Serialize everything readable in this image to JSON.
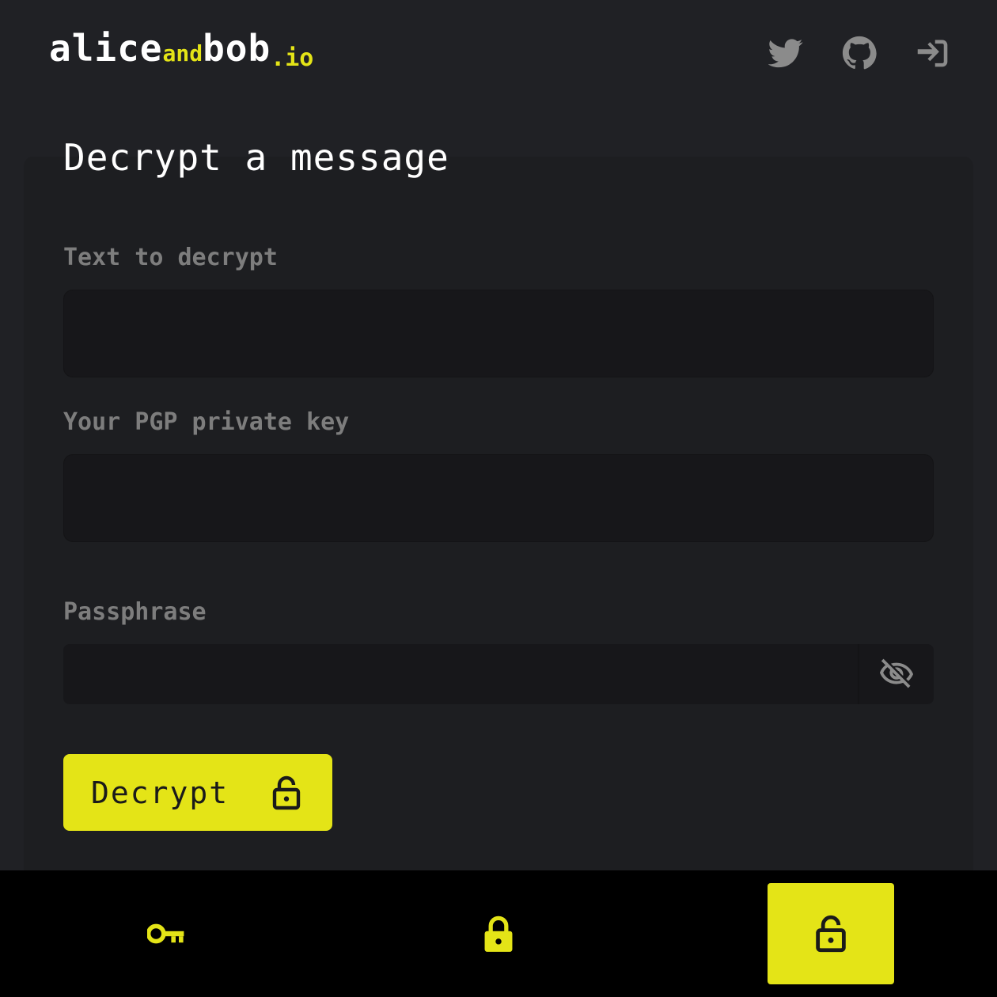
{
  "header": {
    "logo": {
      "part1": "alice",
      "part2": "and",
      "part3": "bob",
      "part4": ".io"
    },
    "icons": [
      "twitter-icon",
      "github-icon",
      "sign-in-icon"
    ]
  },
  "main": {
    "title": "Decrypt a message",
    "text_label": "Text to decrypt",
    "text_value": "",
    "key_label": "Your PGP private key",
    "key_value": "",
    "passphrase_label": "Passphrase",
    "passphrase_value": "",
    "decrypt_button": "Decrypt"
  },
  "bottom_nav": {
    "tabs": [
      {
        "icon": "key-icon",
        "active": false
      },
      {
        "icon": "lock-icon",
        "active": false
      },
      {
        "icon": "unlock-icon",
        "active": true
      }
    ]
  },
  "colors": {
    "accent": "#e4e417",
    "background": "#202125",
    "card": "#1d1e21",
    "input": "#17171a",
    "label": "#7d7d7d",
    "icon": "#8b8b8b"
  }
}
